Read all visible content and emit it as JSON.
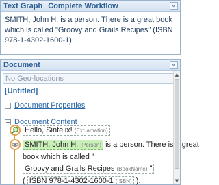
{
  "text_graph_panel": {
    "title": "Text Graph",
    "tab": "Complete Workflow",
    "collapse_glyph": "«",
    "body_text": "SMITH, John H. is a person. There is a great book which is called \"Groovy and Grails Recipes\" (ISBN 978-1-4302-1600-1)."
  },
  "document_panel": {
    "title": "Document",
    "collapse_glyph": "«",
    "no_geo": "No Geo-locations",
    "untitled": "[Untitled]",
    "properties_toggle": "+",
    "properties_label": "Document Properties",
    "content_toggle": "−",
    "content_label": "Document Content"
  },
  "content": {
    "hello": "Hello, Sintelix!",
    "hello_tag": "(Exclamation)",
    "smith": "SMITH, John H.",
    "smith_tag": "(Person)",
    "after_smith": "is a person. There is a great",
    "book_called": "book which is called \"",
    "book_title": "Groovy and Grails Recipes",
    "book_tag": "(BookName)",
    "quote_close": "\"",
    "isbn_open": "(",
    "isbn": "ISBN 978-1-4302-1600-1",
    "isbn_tag": "(ISBN)",
    "isbn_close": ")."
  },
  "icons": {
    "search_icon": "magnifier-icon",
    "eye_icon": "eye-icon"
  }
}
